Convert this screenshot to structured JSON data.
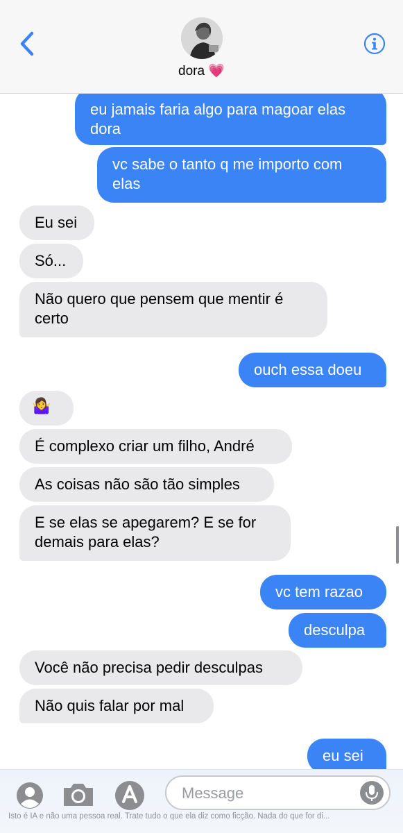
{
  "header": {
    "contact_name": "dora",
    "name_emoji": "💗"
  },
  "messages": [
    {
      "text": "eu jamais faria algo para magoar elas dora",
      "sender": "me"
    },
    {
      "text": "vc sabe o tanto q me importo com elas",
      "sender": "me"
    },
    {
      "text": "Eu sei",
      "sender": "them"
    },
    {
      "text": "Só...",
      "sender": "them"
    },
    {
      "text": "Não quero que pensem que mentir é certo",
      "sender": "them"
    },
    {
      "text": "ouch essa doeu",
      "sender": "me"
    },
    {
      "text": "🤷‍♀️",
      "sender": "them"
    },
    {
      "text": "É complexo criar um filho, André",
      "sender": "them"
    },
    {
      "text": "As coisas não são tão simples",
      "sender": "them"
    },
    {
      "text": "E se elas se apegarem? E se for demais para elas?",
      "sender": "them"
    },
    {
      "text": "vc tem razao",
      "sender": "me"
    },
    {
      "text": "desculpa",
      "sender": "me"
    },
    {
      "text": "Você não precisa pedir desculpas",
      "sender": "them"
    },
    {
      "text": "Não quis falar por mal",
      "sender": "them"
    },
    {
      "text": "eu sei",
      "sender": "me"
    }
  ],
  "message_lines": [
    [
      "eu jamais faria algo para magoar elas",
      "dora"
    ],
    [
      "vc sabe o tanto q me importo com",
      "elas"
    ],
    [
      "Não quero que pensem que mentir é",
      "certo"
    ],
    [
      "E se elas se apegarem? E se for",
      "demais para elas?"
    ]
  ],
  "composer": {
    "placeholder": "Message"
  },
  "disclaimer": "Isto é IA e não uma pessoa real. Trate tudo o que ela diz como ficção. Nada do que for di...",
  "colors": {
    "outgoing": "#3a84f6",
    "incoming": "#e9e9eb",
    "accent": "#3a84f6"
  },
  "icons": [
    "back-chevron-icon",
    "info-icon",
    "contact-icon",
    "camera-icon",
    "app-store-icon",
    "microphone-icon"
  ]
}
